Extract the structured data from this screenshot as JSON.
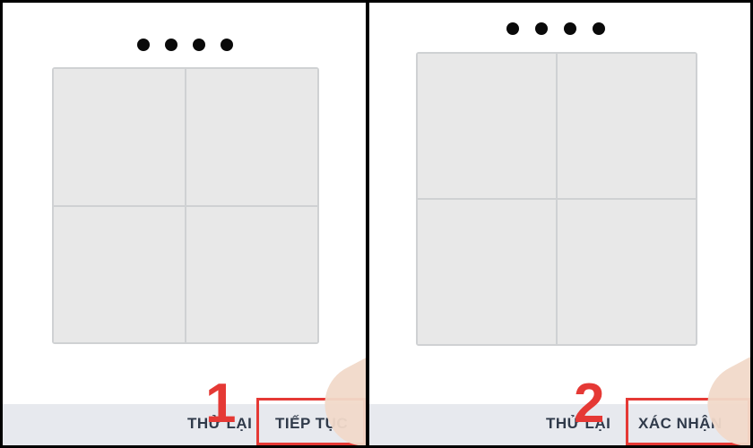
{
  "panels": [
    {
      "step_number": "1",
      "retry_label": "THỬ LẠI",
      "action_label": "TIẾP TỤC"
    },
    {
      "step_number": "2",
      "retry_label": "THỬ LẠI",
      "action_label": "XÁC NHẬN"
    }
  ],
  "colors": {
    "highlight": "#e53935",
    "grid_cell": "#e8e8e8",
    "bar": "#e7e9ee"
  }
}
